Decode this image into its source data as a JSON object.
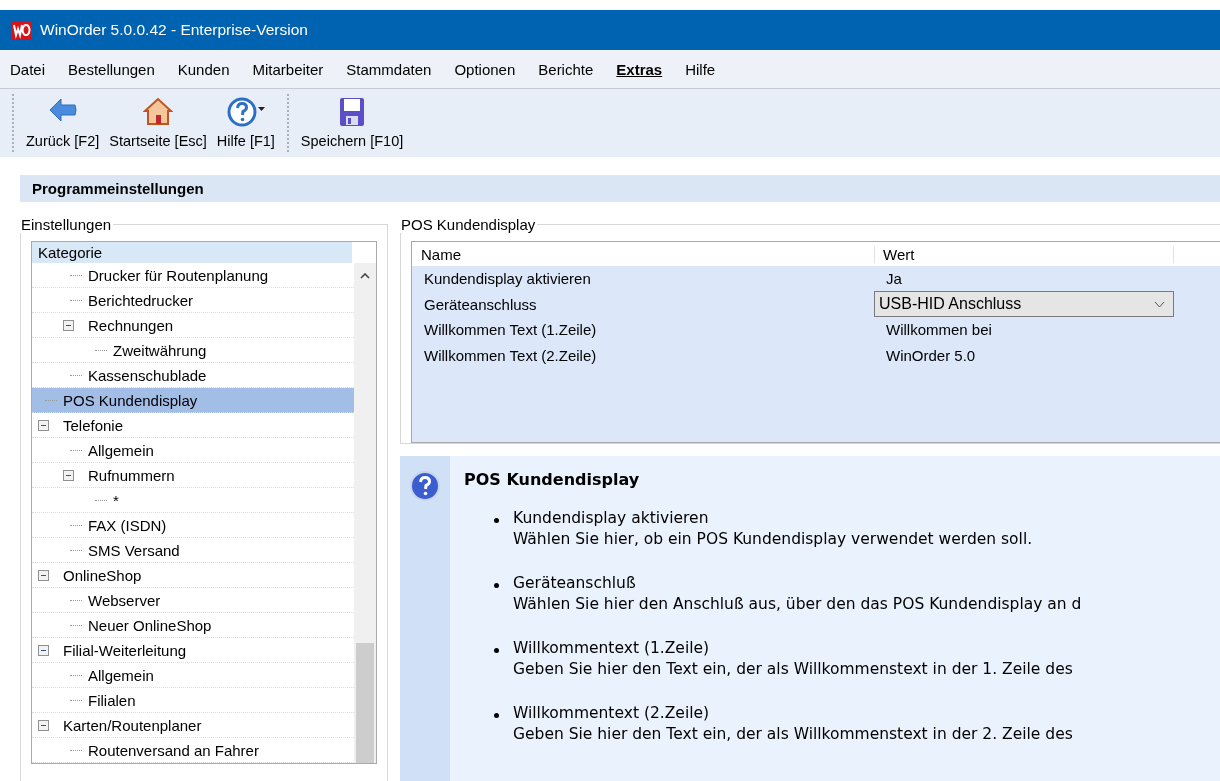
{
  "window": {
    "title": "WinOrder 5.0.0.42 - Enterprise-Version"
  },
  "menu": [
    {
      "label": "Datei",
      "selected": false
    },
    {
      "label": "Bestellungen",
      "selected": false
    },
    {
      "label": "Kunden",
      "selected": false
    },
    {
      "label": "Mitarbeiter",
      "selected": false
    },
    {
      "label": "Stammdaten",
      "selected": false
    },
    {
      "label": "Optionen",
      "selected": false
    },
    {
      "label": "Berichte",
      "selected": false
    },
    {
      "label": "Extras",
      "selected": true
    },
    {
      "label": "Hilfe",
      "selected": false
    }
  ],
  "toolbar": [
    [
      {
        "label": "Zurück [F2]",
        "has_menu": false
      },
      {
        "label": "Startseite [Esc]",
        "has_menu": false
      },
      {
        "label": "Hilfe [F1]",
        "has_menu": true
      }
    ],
    [
      {
        "label": "Speichern [F10]",
        "has_menu": false
      }
    ]
  ],
  "page_title": "Programmeinstellungen",
  "settings": {
    "title": "Einstellungen",
    "header": "Kategorie",
    "continued_items": [
      {
        "label": "Drucker für Routenplanung",
        "selected": false
      },
      {
        "label": "Berichtedrucker",
        "selected": false
      },
      {
        "label": "Rechnungen",
        "selected": false,
        "expanded": true,
        "children": [
          {
            "label": "Zweitwährung",
            "selected": false
          }
        ]
      },
      {
        "label": "Kassenschublade",
        "selected": false
      }
    ],
    "items": [
      {
        "label": "POS Kundendisplay",
        "selected": true
      },
      {
        "label": "Telefonie",
        "selected": false,
        "expanded": true,
        "children": [
          {
            "label": "Allgemein",
            "selected": false
          },
          {
            "label": "Rufnummern",
            "selected": false,
            "expanded": true,
            "children": [
              {
                "label": "*",
                "selected": false
              }
            ]
          },
          {
            "label": "FAX (ISDN)",
            "selected": false
          },
          {
            "label": "SMS Versand",
            "selected": false
          }
        ]
      },
      {
        "label": "OnlineShop",
        "selected": false,
        "expanded": true,
        "children": [
          {
            "label": "Webserver",
            "selected": false
          },
          {
            "label": "Neuer OnlineShop",
            "selected": false
          }
        ]
      },
      {
        "label": "Filial-Weiterleitung",
        "selected": false,
        "expanded": true,
        "children": [
          {
            "label": "Allgemein",
            "selected": false
          },
          {
            "label": "Filialen",
            "selected": false
          }
        ]
      },
      {
        "label": "Karten/Routenplaner",
        "selected": false,
        "expanded": true,
        "children": [
          {
            "label": "Routenversand an Fahrer",
            "selected": false
          }
        ]
      }
    ]
  },
  "properties": {
    "title": "POS Kundendisplay",
    "columns": [
      "Name",
      "Wert"
    ],
    "rows": [
      {
        "kind": "text",
        "name": "Kundendisplay aktivieren",
        "value": "Ja"
      },
      {
        "kind": "dropdown",
        "name": "Geräteanschluss",
        "value": "USB-HID Anschluss"
      },
      {
        "kind": "text",
        "name": "Willkommen Text (1.Zeile)",
        "value": "Willkommen bei"
      },
      {
        "kind": "text",
        "name": "Willkommen Text (2.Zeile)",
        "value": "WinOrder 5.0"
      }
    ]
  },
  "help": {
    "title": "POS Kundendisplay",
    "items": [
      {
        "heading": "Kundendisplay aktivieren",
        "text": "Wählen Sie hier, ob ein POS Kundendisplay verwendet werden soll."
      },
      {
        "heading": "Geräteanschluß",
        "text": "Wählen Sie hier den Anschluß aus, über den das POS Kundendisplay an d"
      },
      {
        "heading": "Willkommentext (1.Zeile)",
        "text": "Geben Sie hier den Text ein, der als Willkommenstext in der 1. Zeile des"
      },
      {
        "heading": "Willkommentext (2.Zeile)",
        "text": "Geben Sie hier den Text ein, der als Willkommenstext in der 2. Zeile des"
      }
    ]
  }
}
